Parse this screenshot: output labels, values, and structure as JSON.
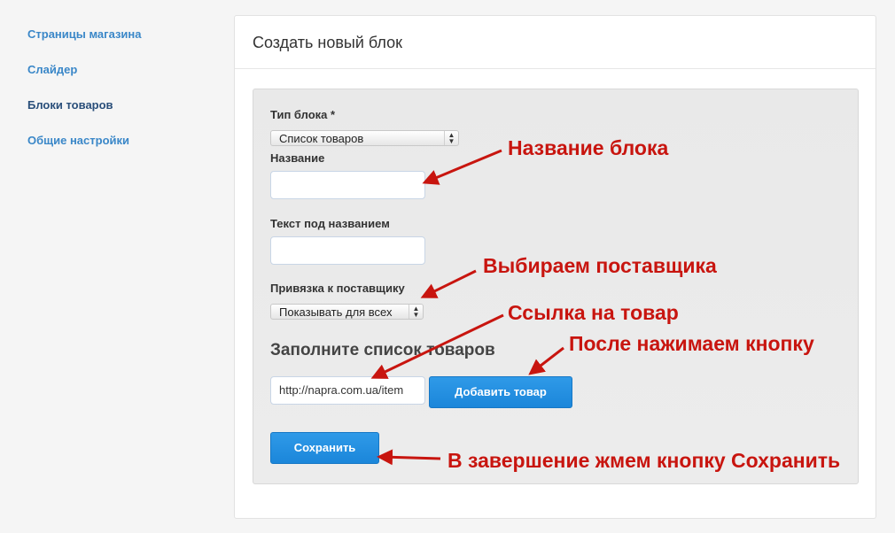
{
  "sidebar": {
    "items": [
      {
        "label": "Страницы магазина"
      },
      {
        "label": "Слайдер"
      },
      {
        "label": "Блоки товаров",
        "active": true
      },
      {
        "label": "Общие настройки"
      }
    ]
  },
  "panel": {
    "title": "Создать новый блок"
  },
  "form": {
    "block_type_label": "Тип блока *",
    "block_type_value": "Список товаров",
    "name_label": "Название",
    "name_value": "",
    "subtitle_label": "Текст под названием",
    "subtitle_value": "",
    "supplier_label": "Привязка к поставщику",
    "supplier_value": "Показывать для всех",
    "products_title": "Заполните список товаров",
    "product_url_value": "http://napra.com.ua/item",
    "add_product_button": "Добавить товар",
    "save_button": "Сохранить"
  },
  "annotations": {
    "block_name": "Название блока",
    "choose_supplier": "Выбираем поставщика",
    "product_link": "Ссылка на товар",
    "then_press": "После нажимаем кнопку",
    "finally_save": "В завершение жмем кнопку Сохранить"
  },
  "colors": {
    "annotation": "#c8150f",
    "accent_button": "#1e8ddd",
    "sidebar_link": "#3a87c8"
  }
}
